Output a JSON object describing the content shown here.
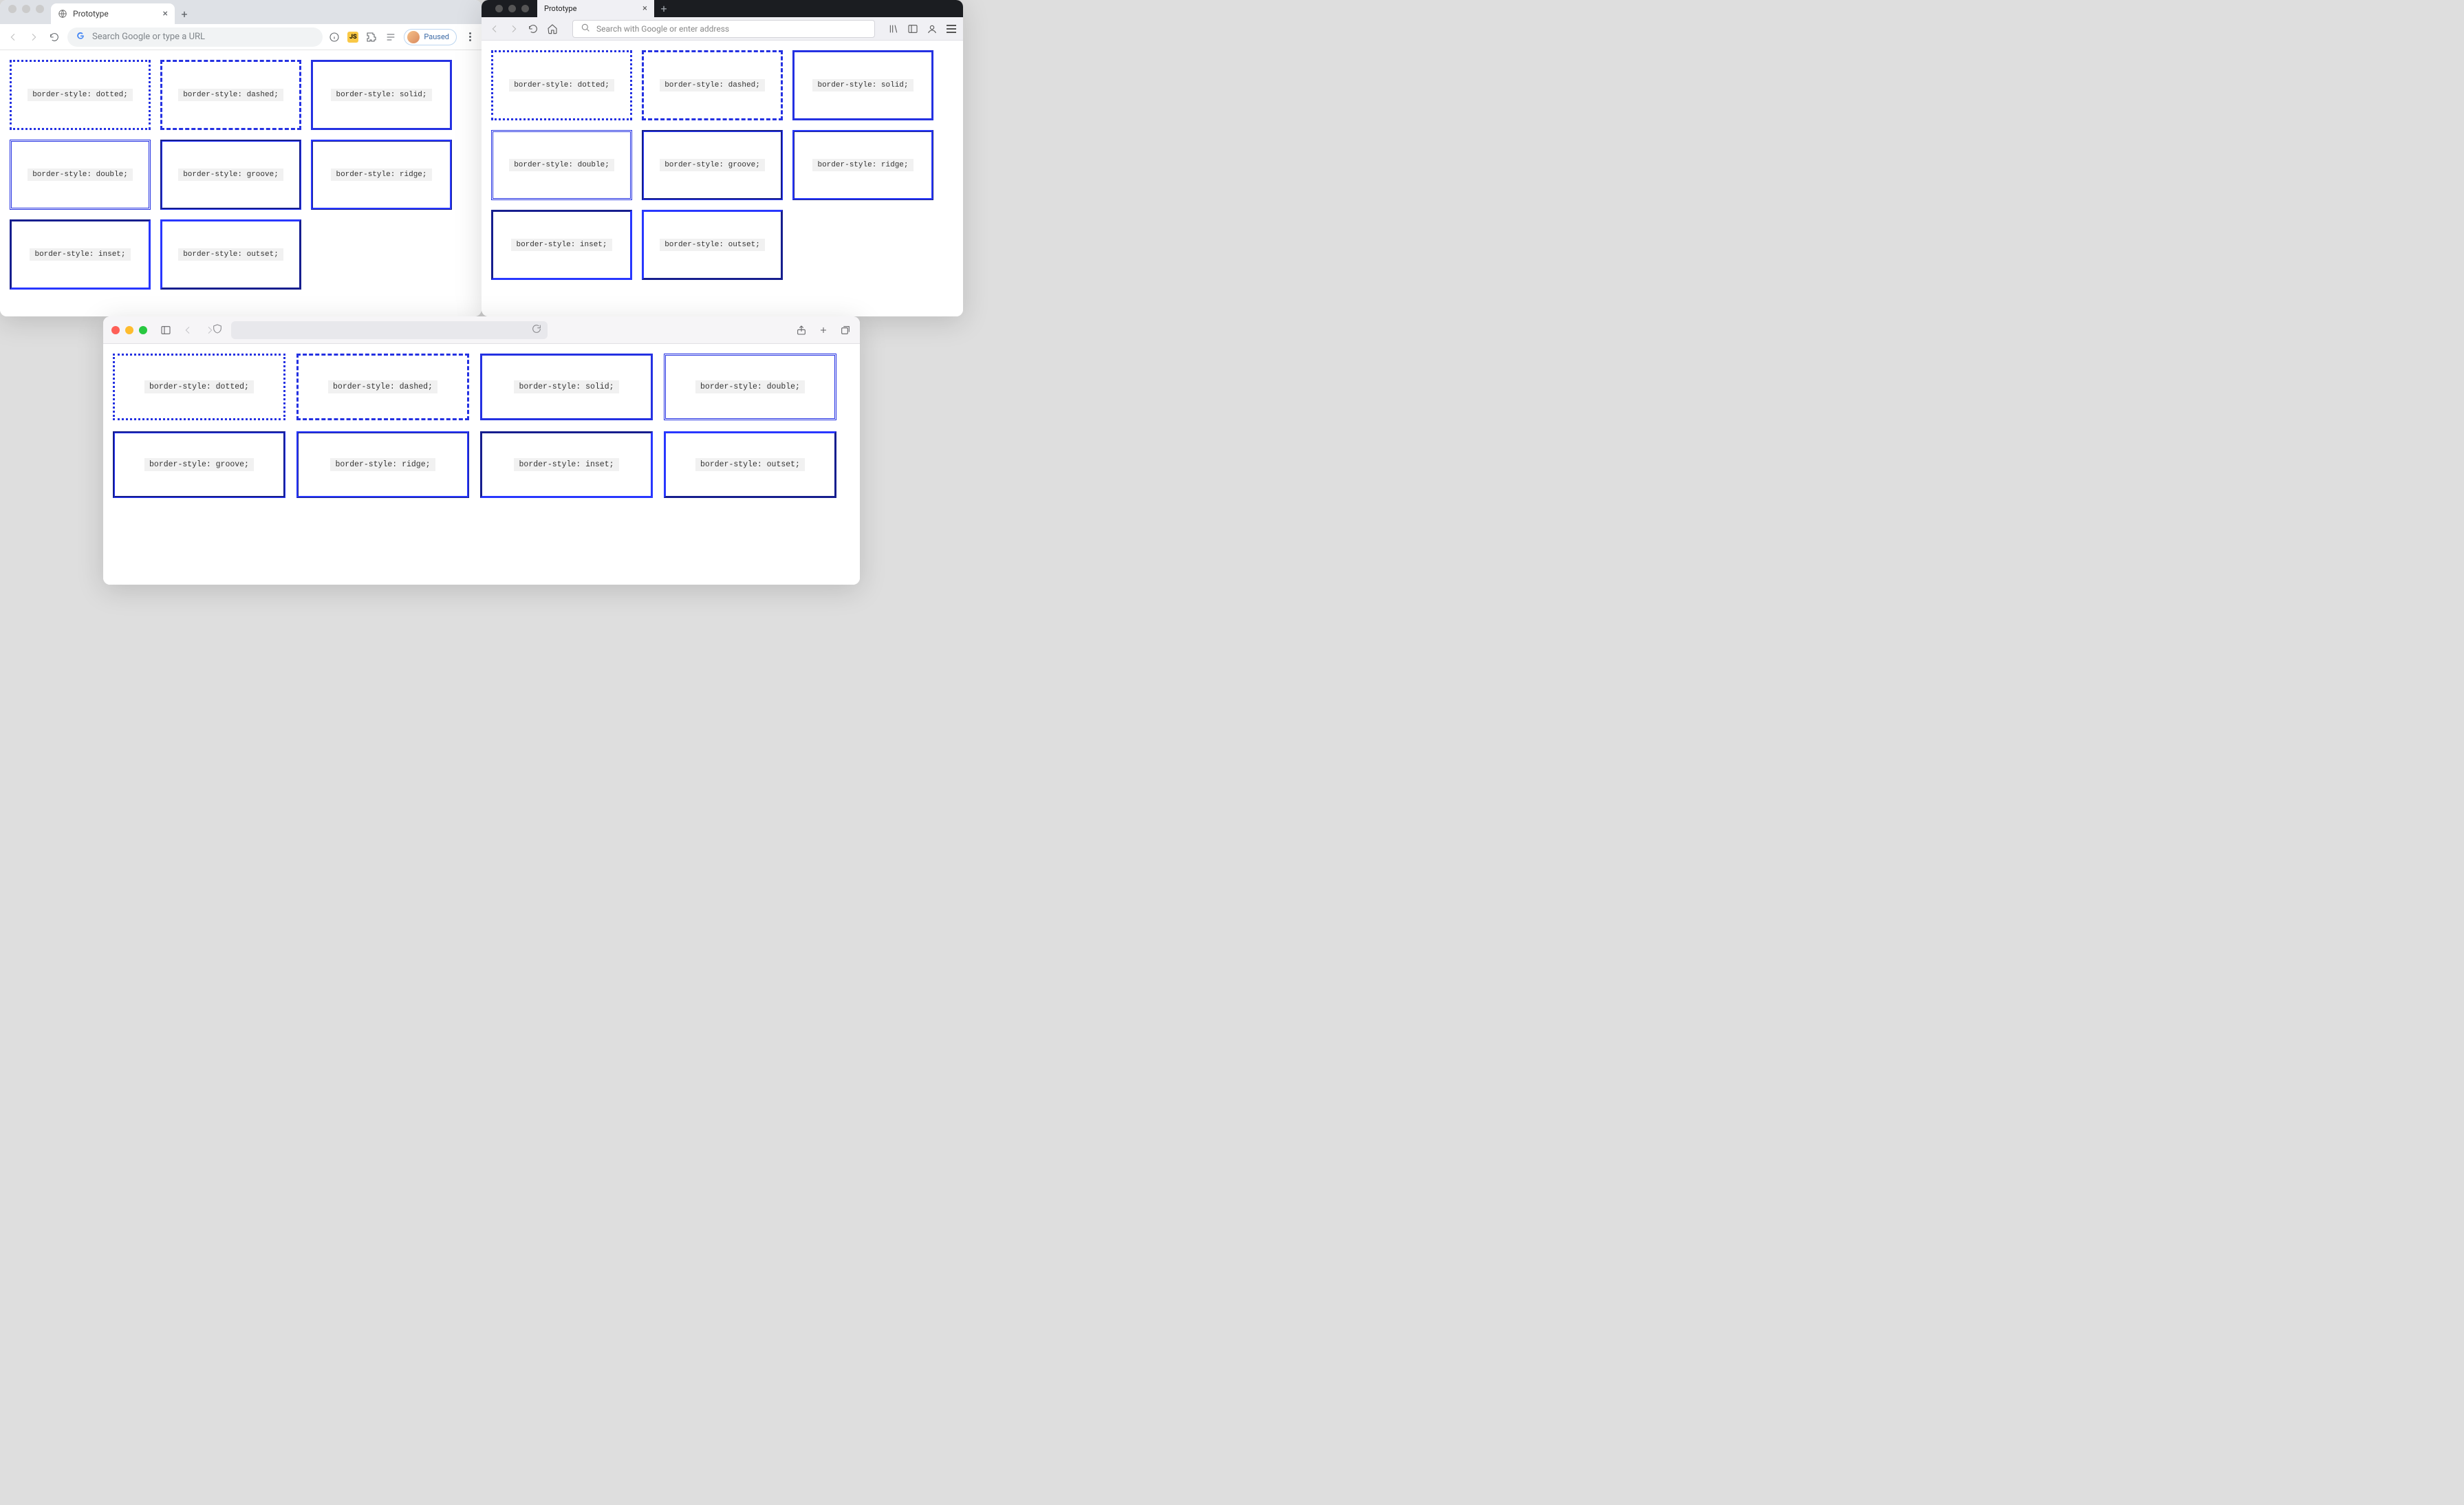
{
  "chrome": {
    "tab_title": "Prototype",
    "omnibox_placeholder": "Search Google or type a URL",
    "profile_label": "Paused"
  },
  "firefox": {
    "tab_title": "Prototype",
    "urlbar_placeholder": "Search with Google or enter address"
  },
  "safari": {
    "urlbar_placeholder": ""
  },
  "border_styles": [
    "border-style: dotted;",
    "border-style: dashed;",
    "border-style: solid;",
    "border-style: double;",
    "border-style: groove;",
    "border-style: ridge;",
    "border-style: inset;",
    "border-style: outset;"
  ],
  "border_css_values": [
    "dotted",
    "dashed",
    "solid",
    "double",
    "groove",
    "ridge",
    "inset",
    "outset"
  ],
  "border_color": "#2431e2"
}
